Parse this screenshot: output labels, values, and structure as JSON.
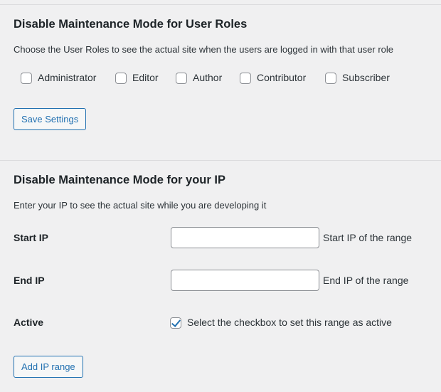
{
  "roles_section": {
    "title": "Disable Maintenance Mode for User Roles",
    "description": "Choose the User Roles to see the actual site when the users are logged in with that user role",
    "roles": [
      {
        "label": "Administrator",
        "checked": false
      },
      {
        "label": "Editor",
        "checked": false
      },
      {
        "label": "Author",
        "checked": false
      },
      {
        "label": "Contributor",
        "checked": false
      },
      {
        "label": "Subscriber",
        "checked": false
      }
    ],
    "save_label": "Save Settings"
  },
  "ip_section": {
    "title": "Disable Maintenance Mode for your IP",
    "description": "Enter your IP to see the actual site while you are developing it",
    "start_ip": {
      "label": "Start IP",
      "value": "",
      "hint": "Start IP of the range"
    },
    "end_ip": {
      "label": "End IP",
      "value": "",
      "hint": "End IP of the range"
    },
    "active": {
      "label": "Active",
      "checked": true,
      "hint": "Select the checkbox to set this range as active"
    },
    "add_label": "Add IP range"
  },
  "colors": {
    "accent": "#2271b1",
    "background": "#f0f0f1",
    "divider": "#dcdcde"
  }
}
